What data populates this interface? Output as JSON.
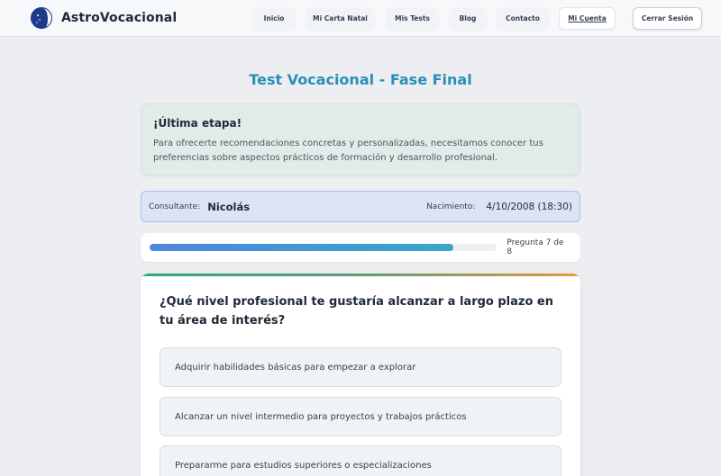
{
  "header": {
    "brand": "AstroVocacional",
    "nav": [
      {
        "label": "Inicio",
        "active": false
      },
      {
        "label": "Mi Carta Natal",
        "active": false
      },
      {
        "label": "Mis Tests",
        "active": false
      },
      {
        "label": "Blog",
        "active": false
      },
      {
        "label": "Contacto",
        "active": false
      },
      {
        "label": "Mi Cuenta",
        "active": true
      }
    ],
    "logout": "Cerrar Sesión"
  },
  "page": {
    "title": "Test Vocacional - Fase Final"
  },
  "info": {
    "title": "¡Última etapa!",
    "text": "Para ofrecerte recomendaciones concretas y personalizadas, necesitamos conocer tus preferencias sobre aspectos prácticos de formación y desarrollo profesional."
  },
  "consultant": {
    "label": "Consultante:",
    "name": "Nicolás",
    "birth_label": "Nacimiento:",
    "birth_value": "4/10/2008 (18:30)"
  },
  "progress": {
    "fraction": 0.875,
    "text": "Pregunta 7 de 8"
  },
  "question": {
    "text": "¿Qué nivel profesional te gustaría alcanzar a largo plazo en tu área de interés?",
    "options": [
      "Adquirir habilidades básicas para empezar a explorar",
      "Alcanzar un nivel intermedio para proyectos y trabajos prácticos",
      "Prepararme para estudios superiores o especializaciones"
    ]
  },
  "colors": {
    "title": "#2a8fb8",
    "progress_start": "#4f86e0",
    "progress_end": "#38a6c9",
    "info_bg": "#e2ebe8",
    "consultant_border": "#a8bdf0"
  }
}
